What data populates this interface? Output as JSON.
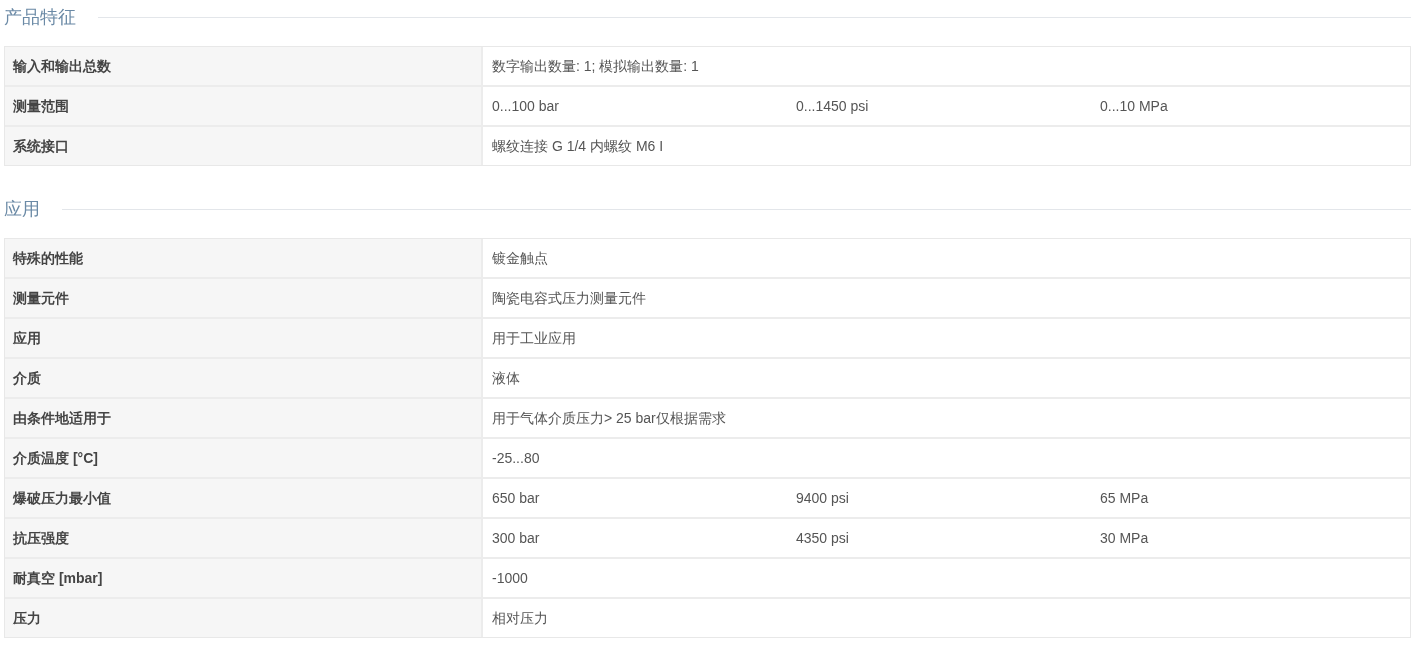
{
  "sections": [
    {
      "title": "产品特征",
      "rows": [
        {
          "label": "输入和输出总数",
          "values": [
            "数字输出数量: 1; 模拟输出数量: 1"
          ]
        },
        {
          "label": "测量范围",
          "values": [
            "0...100 bar",
            "0...1450 psi",
            "0...10 MPa"
          ]
        },
        {
          "label": "系统接口",
          "values": [
            "螺纹连接 G 1/4 内螺纹 M6 I"
          ]
        }
      ]
    },
    {
      "title": "应用",
      "rows": [
        {
          "label": "特殊的性能",
          "values": [
            "镀金触点"
          ]
        },
        {
          "label": "测量元件",
          "values": [
            "陶瓷电容式压力测量元件"
          ]
        },
        {
          "label": "应用",
          "values": [
            "用于工业应用"
          ]
        },
        {
          "label": "介质",
          "values": [
            "液体"
          ]
        },
        {
          "label": "由条件地适用于",
          "values": [
            "用于气体介质压力> 25 bar仅根据需求"
          ]
        },
        {
          "label": "介质温度 [°C]",
          "values": [
            "-25...80"
          ]
        },
        {
          "label": "爆破压力最小值",
          "values": [
            "650 bar",
            "9400 psi",
            "65 MPa"
          ]
        },
        {
          "label": "抗压强度",
          "values": [
            "300 bar",
            "4350 psi",
            "30 MPa"
          ]
        },
        {
          "label": "耐真空 [mbar]",
          "values": [
            "-1000"
          ]
        },
        {
          "label": "压力",
          "values": [
            "相对压力"
          ]
        }
      ]
    }
  ]
}
